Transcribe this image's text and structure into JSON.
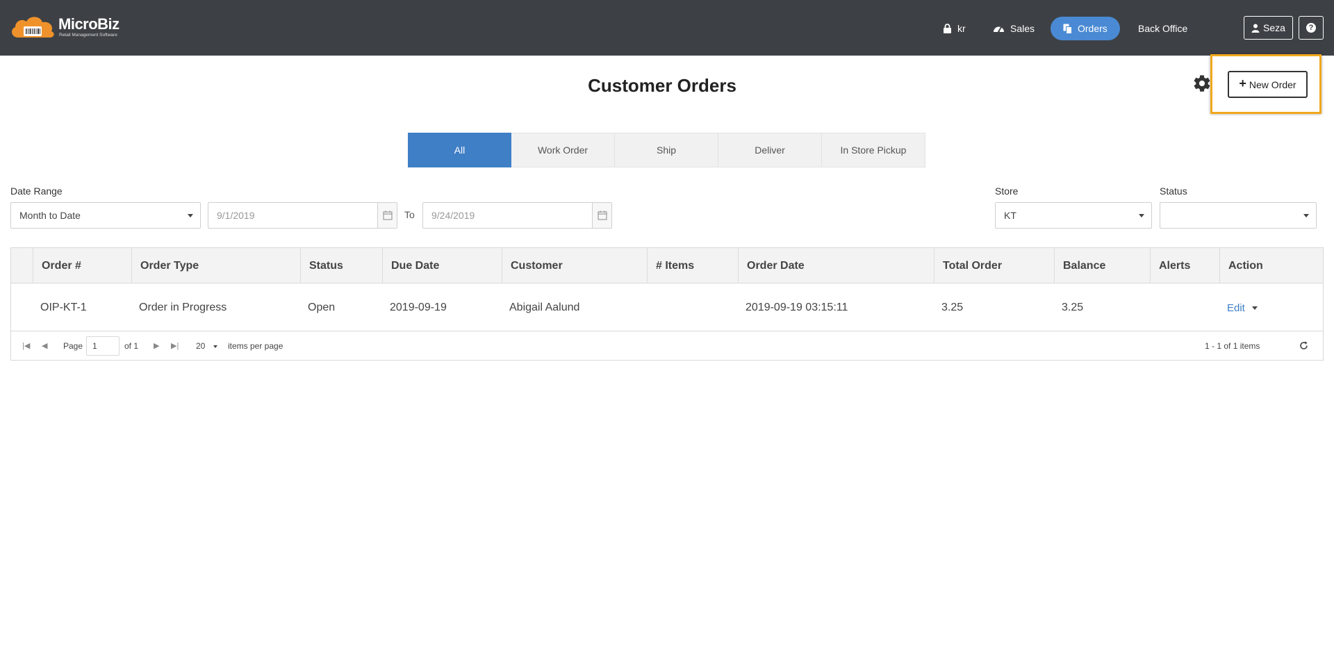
{
  "app": {
    "brand": "MicroBiz",
    "brand_sub": "Retail Management Software"
  },
  "header": {
    "lock_label": "kr",
    "sales_label": "Sales",
    "orders_label": "Orders",
    "back_office_label": "Back Office",
    "user_label": "Seza",
    "help_label": "?"
  },
  "page": {
    "title": "Customer Orders",
    "new_order_label": "New Order"
  },
  "tabs": [
    "All",
    "Work Order",
    "Ship",
    "Deliver",
    "In Store Pickup"
  ],
  "filters": {
    "date_range_label": "Date Range",
    "date_range_value": "Month to Date",
    "from_date": "9/1/2019",
    "to_label": "To",
    "to_date": "9/24/2019",
    "store_label": "Store",
    "store_value": "KT",
    "status_label": "Status",
    "status_value": ""
  },
  "grid": {
    "columns": [
      "Order #",
      "Order Type",
      "Status",
      "Due Date",
      "Customer",
      "# Items",
      "Order Date",
      "Total Order",
      "Balance",
      "Alerts",
      "Action"
    ],
    "rows": [
      {
        "order_no": "OIP-KT-1",
        "order_type": "Order in Progress",
        "status": "Open",
        "due_date": "2019-09-19",
        "customer": "Abigail Aalund",
        "items": "",
        "order_date": "2019-09-19 03:15:11",
        "total": "3.25",
        "balance": "3.25",
        "alerts": "",
        "action": "Edit"
      }
    ],
    "pager": {
      "page_label": "Page",
      "page_value": "1",
      "of_label": "of 1",
      "per_page_value": "20",
      "per_page_label": "items per page",
      "summary": "1 - 1 of 1 items"
    }
  },
  "colors": {
    "header_bg": "#3d4145",
    "accent": "#3f7fc6",
    "highlight": "#f0a81c"
  }
}
